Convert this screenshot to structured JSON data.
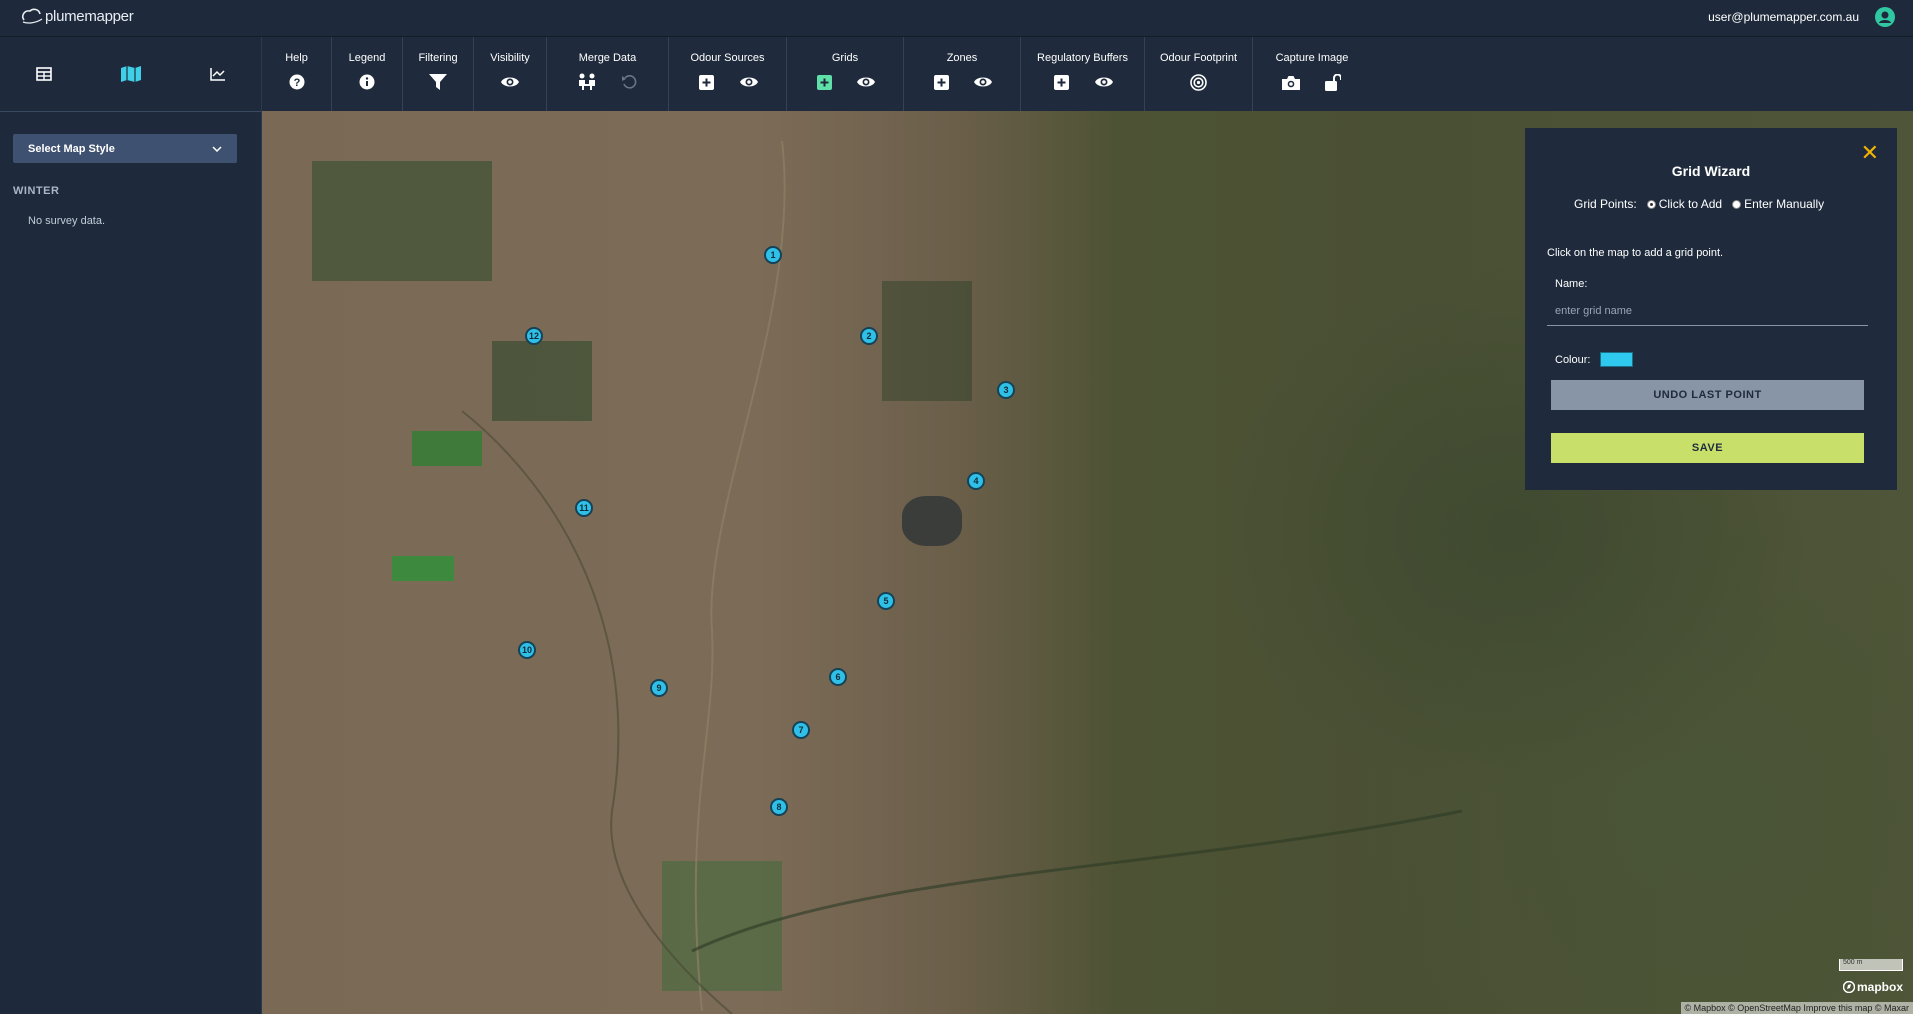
{
  "header": {
    "logo_text": "plumemapper",
    "user_email": "user@plumemapper.com.au"
  },
  "sidebar": {
    "tabs": [
      {
        "icon": "table-icon"
      },
      {
        "icon": "map-icon"
      },
      {
        "icon": "chart-icon"
      }
    ],
    "map_style_label": "Select Map Style",
    "season_heading": "WINTER",
    "empty_text": "No survey data."
  },
  "toolbar": {
    "groups": [
      {
        "label": "Help",
        "icons": [
          "help-icon"
        ]
      },
      {
        "label": "Legend",
        "icons": [
          "info-icon"
        ]
      },
      {
        "label": "Filtering",
        "icons": [
          "filter-icon"
        ]
      },
      {
        "label": "Visibility",
        "icons": [
          "eye-icon"
        ]
      },
      {
        "label": "Merge Data",
        "icons": [
          "merge-people-icon",
          "undo-icon"
        ]
      },
      {
        "label": "Odour Sources",
        "icons": [
          "add-icon",
          "eye-icon"
        ]
      },
      {
        "label": "Grids",
        "icons": [
          "add-icon",
          "eye-icon"
        ]
      },
      {
        "label": "Zones",
        "icons": [
          "add-icon",
          "eye-icon"
        ]
      },
      {
        "label": "Regulatory Buffers",
        "icons": [
          "add-icon",
          "eye-icon"
        ]
      },
      {
        "label": "Odour Footprint",
        "icons": [
          "target-icon"
        ]
      },
      {
        "label": "Capture Image",
        "icons": [
          "camera-icon",
          "unlock-icon"
        ]
      }
    ]
  },
  "map": {
    "markers": [
      "1",
      "2",
      "3",
      "4",
      "5",
      "6",
      "7",
      "8",
      "9",
      "10",
      "11",
      "12"
    ],
    "scale_label": "500 m",
    "brand": "mapbox",
    "attribution": "© Mapbox © OpenStreetMap  Improve this map © Maxar"
  },
  "wizard": {
    "title": "Grid Wizard",
    "points_label": "Grid Points:",
    "option_click": "Click to Add",
    "option_manual": "Enter Manually",
    "selected_option": "Click to Add",
    "instruction": "Click on the map to add a grid point.",
    "name_label": "Name:",
    "name_placeholder": "enter grid name",
    "name_value": "",
    "colour_label": "Colour:",
    "colour_value": "#2fc8ee",
    "undo_label": "UNDO LAST POINT",
    "save_label": "SAVE"
  },
  "colors": {
    "panel_bg": "#1f2b3c",
    "accent_marker": "#2fc0e8",
    "close_accent": "#f0b400",
    "save_button": "#c8e06a",
    "grids_add_accent": "#5ee0a8"
  }
}
